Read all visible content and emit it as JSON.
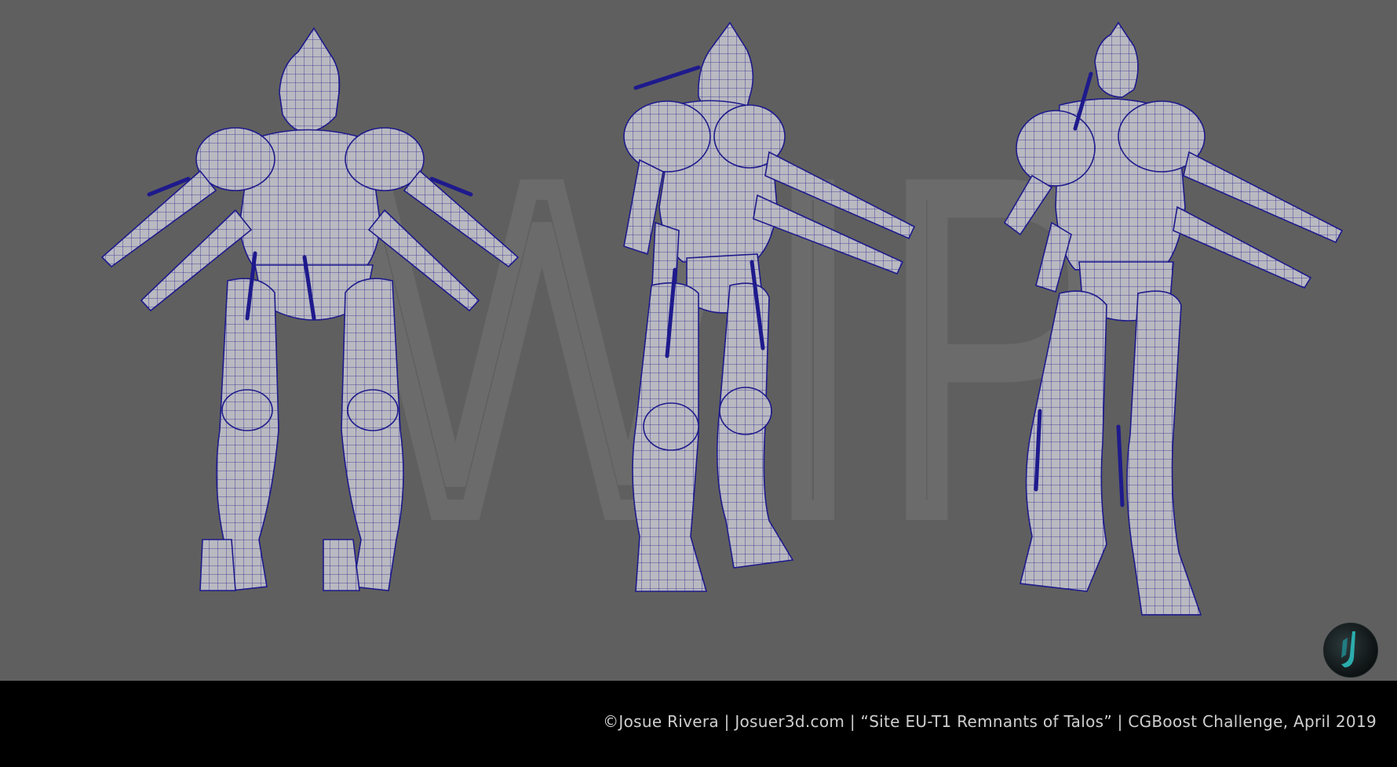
{
  "watermark_text": "WIP",
  "figures": [
    {
      "name": "front-view",
      "view": "front"
    },
    {
      "name": "three-quarter-view",
      "view": "three-quarter"
    },
    {
      "name": "back-view",
      "view": "back"
    }
  ],
  "colors": {
    "background": "#5f5f5f",
    "footer": "#000000",
    "mesh_fill": "#b9b9c1",
    "wire": "#1e1a8c",
    "caption_text": "#cfcfcf",
    "logo_accent": "#2ec4c4"
  },
  "footer": {
    "caption": "©Josue Rivera  |  Josuer3d.com  |  “Site EU-T1 Remnants of Talos”  |  CGBoost Challenge, April 2019"
  },
  "logo": {
    "icon": "artist-logo-icon"
  }
}
